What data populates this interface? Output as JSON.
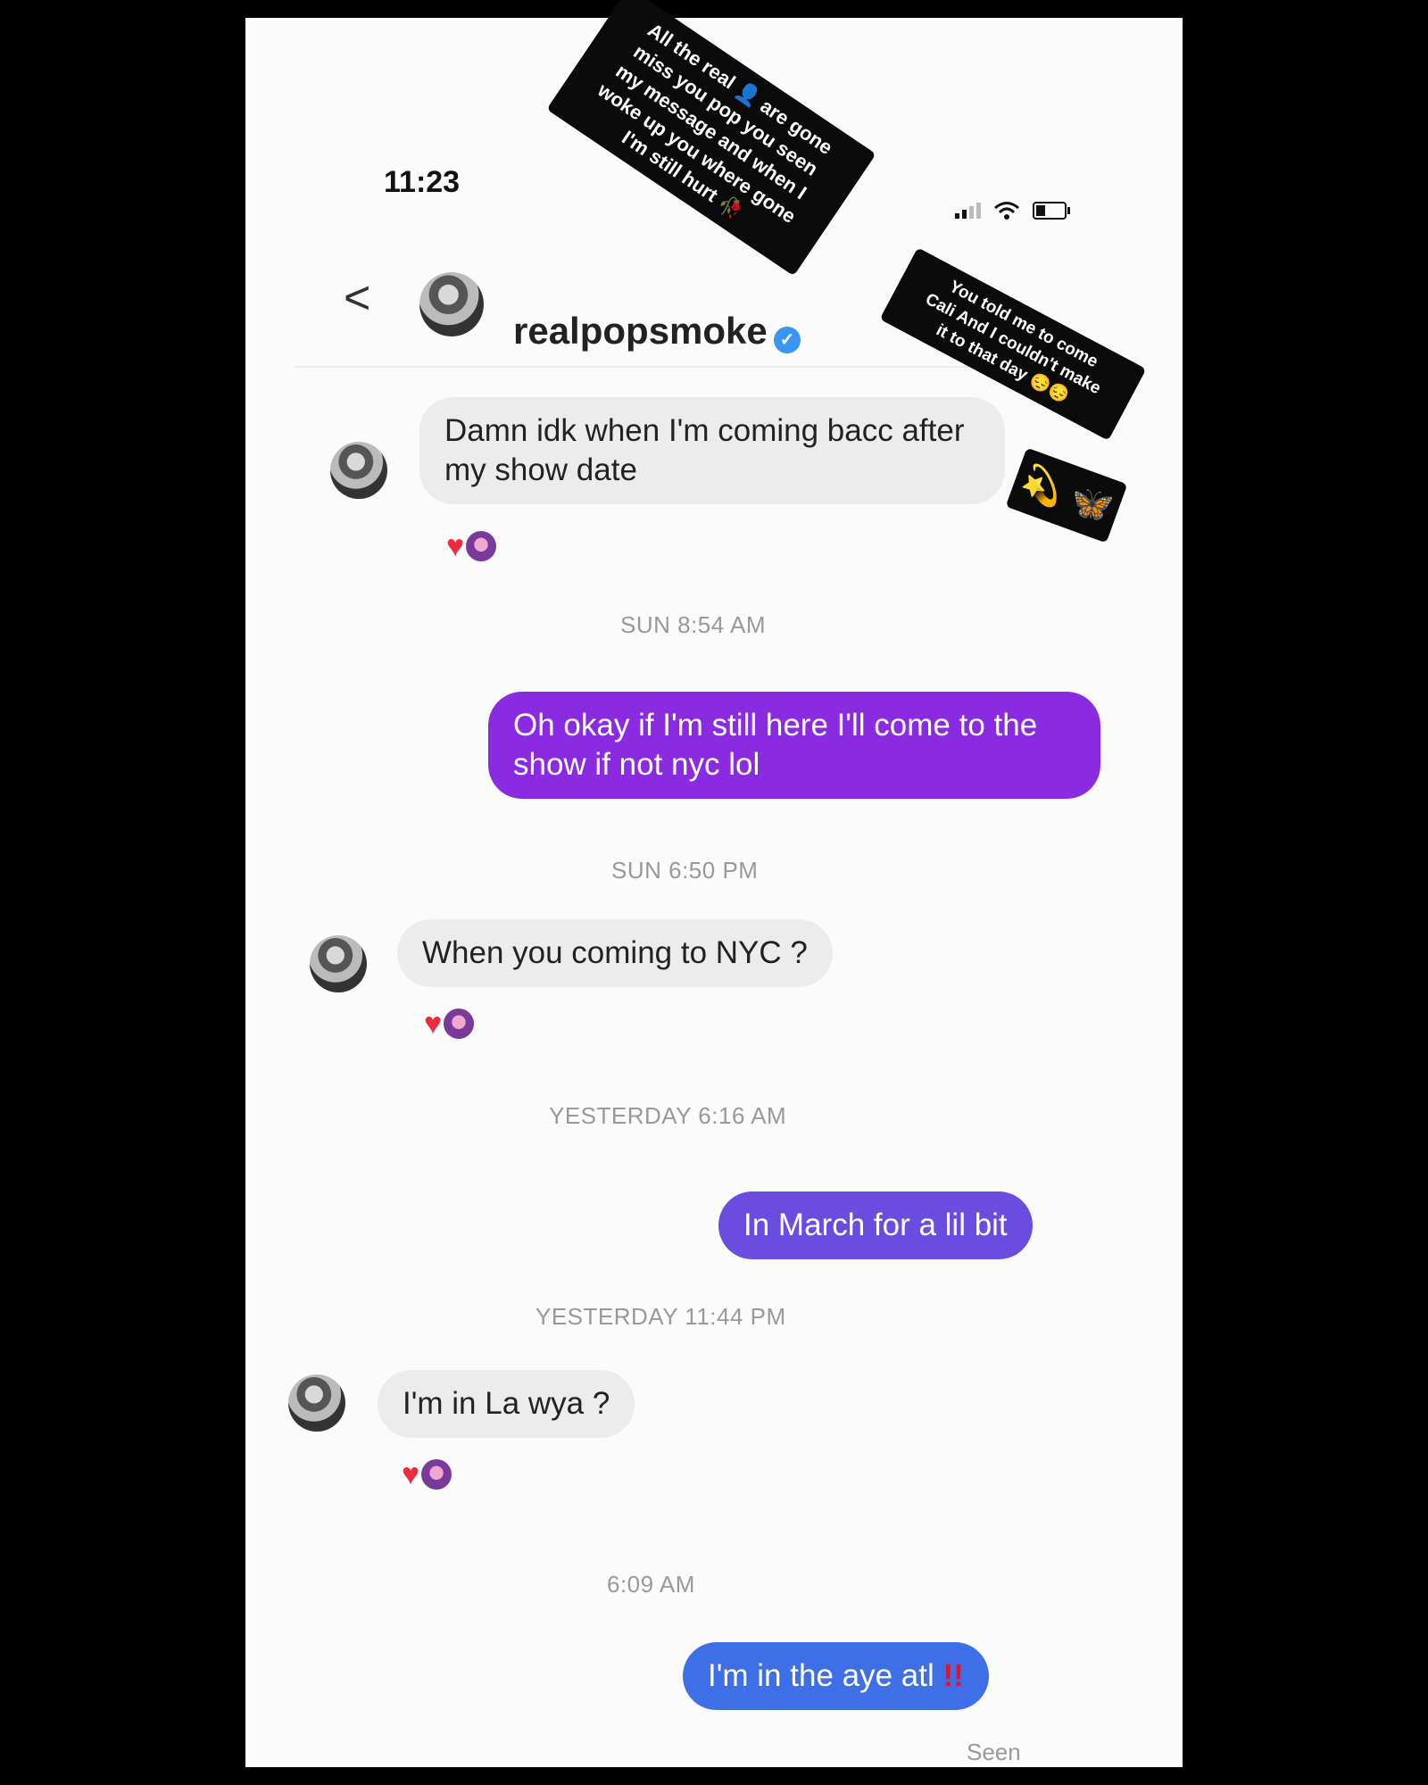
{
  "status_bar": {
    "time": "11:23"
  },
  "header": {
    "back_glyph": "<",
    "username": "realpopsmoke",
    "verified_glyph": "✓"
  },
  "messages": [
    {
      "from": "them",
      "text": "Damn idk when I'm coming bacc after my show date",
      "reactions": [
        "heart-icon",
        "reactor-avatar"
      ]
    },
    {
      "timestamp": "SUN 8:54 AM"
    },
    {
      "from": "me",
      "text": "Oh okay if I'm still here I'll come to the show if not nyc lol",
      "color": "#8a2be2"
    },
    {
      "timestamp": "SUN 6:50 PM"
    },
    {
      "from": "them",
      "text": "When you coming to NYC ?",
      "reactions": [
        "heart-icon",
        "reactor-avatar"
      ]
    },
    {
      "timestamp": "YESTERDAY 6:16 AM"
    },
    {
      "from": "me",
      "text": "In March for a lil bit",
      "color": "#6a4de0"
    },
    {
      "timestamp": "YESTERDAY 11:44 PM"
    },
    {
      "from": "them",
      "text": "I'm in La wya ?",
      "reactions": [
        "heart-icon",
        "reactor-avatar"
      ]
    },
    {
      "timestamp": "6:09 AM"
    },
    {
      "from": "me",
      "text": "I'm in the aye atl",
      "suffix": "!!",
      "color": "#3f6fe6"
    }
  ],
  "seen_label": "Seen",
  "reaction_heart": "♥",
  "stickers": {
    "sticker1": [
      "All the real 👤 are gone",
      "miss you pop you seen",
      "my message and when I",
      "woke up you where gone",
      "I'm still hurt 🥀"
    ],
    "sticker2": [
      "You told me to come",
      "Cali And I couldn't make",
      "it to that day 😔😔"
    ],
    "sticker3": {
      "emoji1": "💫",
      "emoji2": "🦋"
    }
  },
  "colors": {
    "incoming_bubble": "#ececec",
    "outgoing_purple": "#8a2be2",
    "outgoing_violet": "#6a4de0",
    "outgoing_blue": "#3f6fe6",
    "verified_blue": "#3a96f0",
    "heart_red": "#ec2b3f"
  }
}
